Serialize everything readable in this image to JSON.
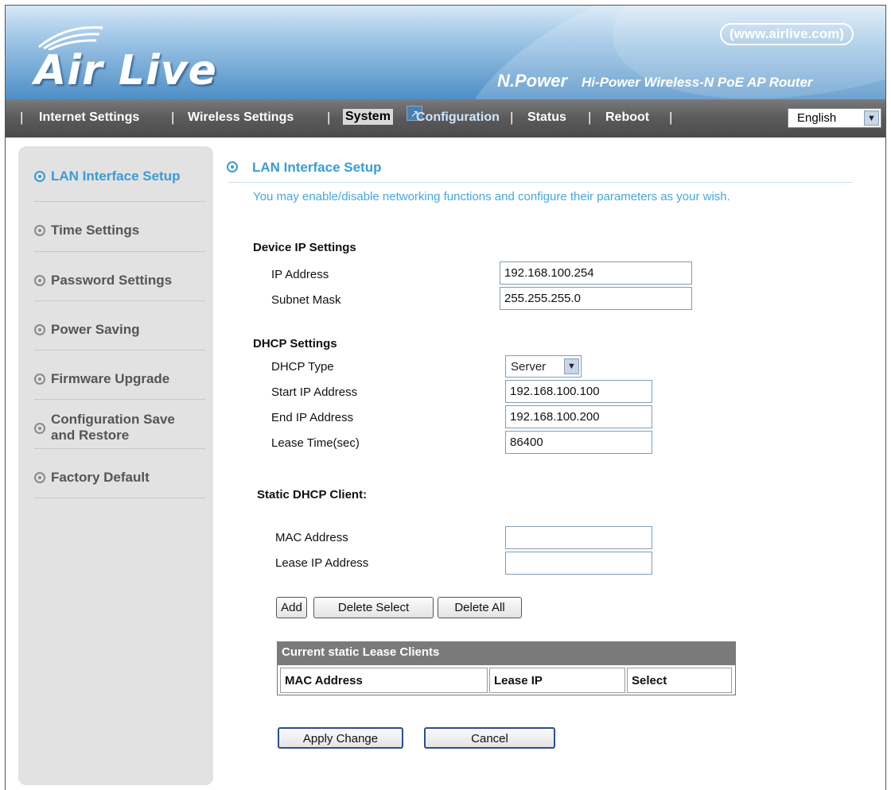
{
  "header": {
    "logo_text": "Air Live",
    "website": "(www.airlive.com)",
    "brand": "N.Power",
    "tagline": "Hi-Power Wireless-N PoE AP Router"
  },
  "nav": {
    "items": [
      "Internet Settings",
      "Wireless Settings",
      "System",
      "Configuration",
      "Status",
      "Reboot"
    ],
    "separator": "|",
    "language": "English"
  },
  "sidebar": {
    "items": [
      {
        "label": "LAN Interface Setup",
        "active": true
      },
      {
        "label": "Time Settings"
      },
      {
        "label": "Password Settings"
      },
      {
        "label": "Power Saving"
      },
      {
        "label": "Firmware Upgrade"
      },
      {
        "label": "Configuration Save\nand Restore"
      },
      {
        "label": "Factory Default"
      }
    ]
  },
  "main": {
    "title": "LAN Interface Setup",
    "description": "You may enable/disable networking functions and configure their parameters as your wish.",
    "device_ip": {
      "heading": "Device IP Settings",
      "ip_label": "IP Address",
      "ip_value": "192.168.100.254",
      "mask_label": "Subnet Mask",
      "mask_value": "255.255.255.0"
    },
    "dhcp": {
      "heading": "DHCP Settings",
      "type_label": "DHCP Type",
      "type_value": "Server",
      "start_label": "Start IP Address",
      "start_value": "192.168.100.100",
      "end_label": "End IP Address",
      "end_value": "192.168.100.200",
      "lease_label": "Lease Time(sec)",
      "lease_value": "86400"
    },
    "static": {
      "heading": "Static DHCP Client:",
      "mac_label": "MAC Address",
      "mac_value": "",
      "lease_ip_label": "Lease IP Address",
      "lease_ip_value": ""
    },
    "buttons": {
      "add": "Add",
      "delete_select": "Delete Select",
      "delete_all": "Delete All",
      "apply": "Apply Change",
      "cancel": "Cancel"
    },
    "table": {
      "caption": "Current static Lease Clients",
      "columns": [
        "MAC Address",
        "Lease IP",
        "Select"
      ]
    }
  },
  "colors": {
    "accent": "#3a9bd6",
    "nav_bg": "#5a5a5a",
    "sidebar_bg": "#e2e2e2",
    "table_head": "#7a7a7a"
  }
}
